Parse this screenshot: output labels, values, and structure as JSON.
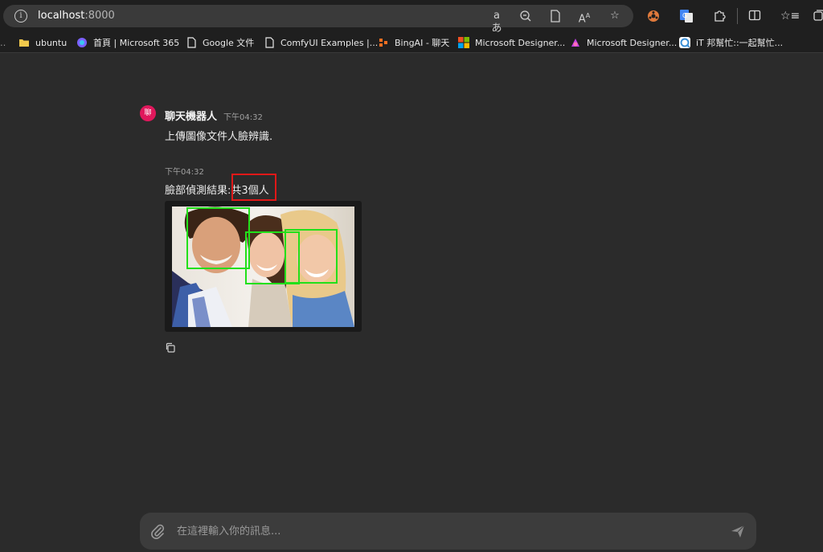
{
  "browser": {
    "url_host": "localhost",
    "url_port": ":8000",
    "toolbar_icons": [
      "read-aloud-icon",
      "zoom-out-icon",
      "reading-view-icon",
      "font-size-icon",
      "favorite-star-icon",
      "extension-wheel-icon",
      "google-translate-icon",
      "extensions-puzzle-icon",
      "split-screen-icon",
      "favorites-list-icon",
      "collections-icon"
    ]
  },
  "bookmarks": [
    {
      "label": "ubuntu",
      "icon": "folder-icon",
      "color": "#f2c94c"
    },
    {
      "label": "首頁 | Microsoft 365",
      "icon": "m365-icon",
      "color": "#7b61ff"
    },
    {
      "label": "Google 文件",
      "icon": "document-icon",
      "color": "#e8e8e8"
    },
    {
      "label": "ComfyUI Examples |...",
      "icon": "document-icon",
      "color": "#e8e8e8"
    },
    {
      "label": "BingAI - 聊天",
      "icon": "bing-icon",
      "color": "#f36f21"
    },
    {
      "label": "Microsoft Designer...",
      "icon": "microsoft-logo-icon",
      "color": "#f25022"
    },
    {
      "label": "Microsoft Designer...",
      "icon": "designer-icon",
      "color": "#c43ee6"
    },
    {
      "label": "iT 邦幫忙::一起幫忙...",
      "icon": "ithome-icon",
      "color": "#3a8fd6"
    }
  ],
  "chat": {
    "avatar_initial": "聊",
    "bot_name": "聊天機器人",
    "first_time": "下午04:32",
    "first_message": "上傳圖像文件人臉辨識.",
    "second_time": "下午04:32",
    "result_prefix": "臉部偵測結果:",
    "result_count": "共3個人",
    "faces_detected": 3
  },
  "composer": {
    "placeholder": "在這裡輸入你的訊息..."
  },
  "colors": {
    "avatar": "#e0185c",
    "face_box": "#22e01a",
    "highlight_box": "#e01818"
  }
}
